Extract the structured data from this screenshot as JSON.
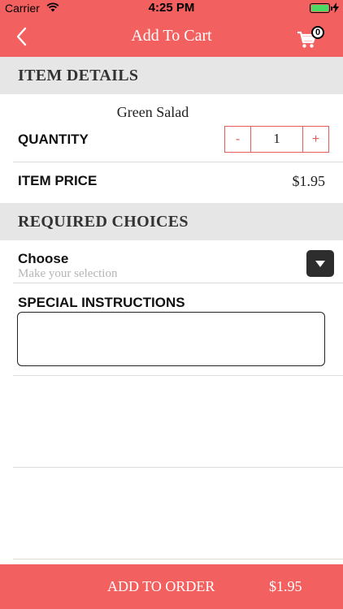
{
  "status_bar": {
    "carrier": "Carrier",
    "time": "4:25 PM",
    "wifi_icon": "wifi-icon",
    "battery_icon": "battery-icon"
  },
  "nav": {
    "title": "Add To Cart",
    "back_icon": "chevron-left-icon",
    "cart_icon": "shopping-cart-icon",
    "cart_count": "0"
  },
  "item_details": {
    "header": "ITEM DETAILS",
    "item_name": "Green Salad",
    "quantity_label": "QUANTITY",
    "minus_label": "-",
    "quantity_value": "1",
    "plus_label": "+",
    "price_label": "ITEM PRICE",
    "price_value": "$1.95"
  },
  "required_choices": {
    "header": "REQUIRED CHOICES",
    "choose_title": "Choose",
    "choose_subtitle": "Make your selection",
    "dropdown_icon": "caret-down-icon"
  },
  "special_instructions": {
    "label": "SPECIAL INSTRUCTIONS",
    "value": ""
  },
  "bottom_bar": {
    "add_label": "ADD TO ORDER",
    "total": "$1.95"
  },
  "colors": {
    "accent": "#f36060",
    "stepper_border": "#e25c5c",
    "section_bg": "#e6e6e6"
  }
}
